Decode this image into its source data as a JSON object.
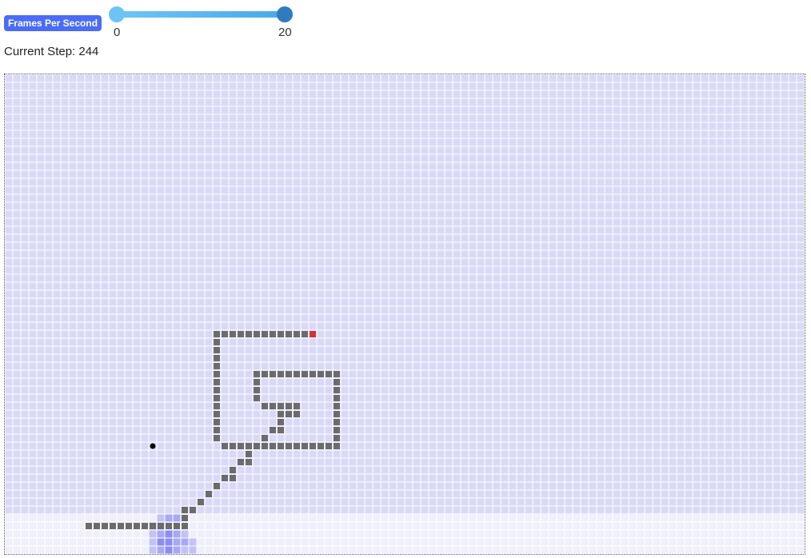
{
  "controls": {
    "fps_label": "Frames Per Second",
    "slider_min": "0",
    "slider_max": "20",
    "slider_value": 20
  },
  "status": {
    "step_label": "Current Step:",
    "step_value": "244",
    "step_text": "Current Step: 244"
  },
  "board": {
    "cols": 100,
    "rows": 60,
    "colors": {
      "grid_fill": "#d9d9f7",
      "grid_line": "#ffffff",
      "bottom_band": "#efeffc",
      "snake_body": "#6b6b6b",
      "snake_head": "#d93030",
      "food": "#000000",
      "heat_strong": "#8c8cf2",
      "heat_medium": "#a8a8f4",
      "heat_light": "#c2c2f6"
    },
    "bottom_band_start_row": 55,
    "food": [
      18,
      46
    ],
    "snake_head": [
      38,
      32
    ],
    "snake_body": [
      [
        26,
        32
      ],
      [
        27,
        32
      ],
      [
        28,
        32
      ],
      [
        29,
        32
      ],
      [
        30,
        32
      ],
      [
        31,
        32
      ],
      [
        32,
        32
      ],
      [
        33,
        32
      ],
      [
        34,
        32
      ],
      [
        35,
        32
      ],
      [
        36,
        32
      ],
      [
        37,
        32
      ],
      [
        26,
        33
      ],
      [
        26,
        34
      ],
      [
        26,
        35
      ],
      [
        26,
        36
      ],
      [
        26,
        37
      ],
      [
        26,
        38
      ],
      [
        26,
        39
      ],
      [
        26,
        40
      ],
      [
        26,
        41
      ],
      [
        26,
        42
      ],
      [
        26,
        43
      ],
      [
        26,
        44
      ],
      [
        26,
        45
      ],
      [
        27,
        46
      ],
      [
        28,
        46
      ],
      [
        29,
        46
      ],
      [
        30,
        46
      ],
      [
        31,
        46
      ],
      [
        32,
        46
      ],
      [
        33,
        46
      ],
      [
        34,
        46
      ],
      [
        35,
        46
      ],
      [
        36,
        46
      ],
      [
        37,
        46
      ],
      [
        38,
        46
      ],
      [
        39,
        46
      ],
      [
        40,
        46
      ],
      [
        41,
        46
      ],
      [
        31,
        37
      ],
      [
        32,
        37
      ],
      [
        33,
        37
      ],
      [
        34,
        37
      ],
      [
        35,
        37
      ],
      [
        36,
        37
      ],
      [
        37,
        37
      ],
      [
        38,
        37
      ],
      [
        39,
        37
      ],
      [
        40,
        37
      ],
      [
        41,
        37
      ],
      [
        41,
        38
      ],
      [
        41,
        39
      ],
      [
        41,
        40
      ],
      [
        41,
        41
      ],
      [
        41,
        42
      ],
      [
        41,
        43
      ],
      [
        41,
        44
      ],
      [
        41,
        45
      ],
      [
        31,
        38
      ],
      [
        31,
        39
      ],
      [
        31,
        40
      ],
      [
        32,
        41
      ],
      [
        33,
        41
      ],
      [
        34,
        41
      ],
      [
        35,
        41
      ],
      [
        36,
        41
      ],
      [
        34,
        42
      ],
      [
        35,
        42
      ],
      [
        36,
        42
      ],
      [
        34,
        43
      ],
      [
        33,
        44
      ],
      [
        34,
        44
      ],
      [
        32,
        45
      ],
      [
        30,
        47
      ],
      [
        29,
        48
      ],
      [
        30,
        48
      ],
      [
        28,
        49
      ],
      [
        27,
        50
      ],
      [
        28,
        50
      ],
      [
        26,
        51
      ],
      [
        25,
        52
      ],
      [
        24,
        53
      ],
      [
        23,
        54
      ],
      [
        22,
        54
      ],
      [
        22,
        55
      ],
      [
        10,
        56
      ],
      [
        11,
        56
      ],
      [
        12,
        56
      ],
      [
        13,
        56
      ],
      [
        14,
        56
      ],
      [
        15,
        56
      ],
      [
        16,
        56
      ],
      [
        17,
        56
      ],
      [
        18,
        56
      ],
      [
        19,
        56
      ],
      [
        20,
        56
      ],
      [
        21,
        56
      ],
      [
        22,
        56
      ]
    ],
    "heat_cells": [
      [
        19,
        55,
        "light"
      ],
      [
        20,
        55,
        "medium"
      ],
      [
        21,
        55,
        "medium"
      ],
      [
        18,
        56,
        "light"
      ],
      [
        19,
        56,
        "light"
      ],
      [
        18,
        57,
        "light"
      ],
      [
        19,
        57,
        "medium"
      ],
      [
        20,
        57,
        "strong"
      ],
      [
        21,
        57,
        "medium"
      ],
      [
        22,
        57,
        "light"
      ],
      [
        18,
        58,
        "light"
      ],
      [
        19,
        58,
        "strong"
      ],
      [
        20,
        58,
        "strong"
      ],
      [
        21,
        58,
        "medium"
      ],
      [
        22,
        58,
        "medium"
      ],
      [
        23,
        58,
        "light"
      ],
      [
        18,
        59,
        "light"
      ],
      [
        19,
        59,
        "medium"
      ],
      [
        20,
        59,
        "strong"
      ],
      [
        21,
        59,
        "medium"
      ],
      [
        22,
        59,
        "light"
      ],
      [
        23,
        59,
        "light"
      ]
    ]
  }
}
